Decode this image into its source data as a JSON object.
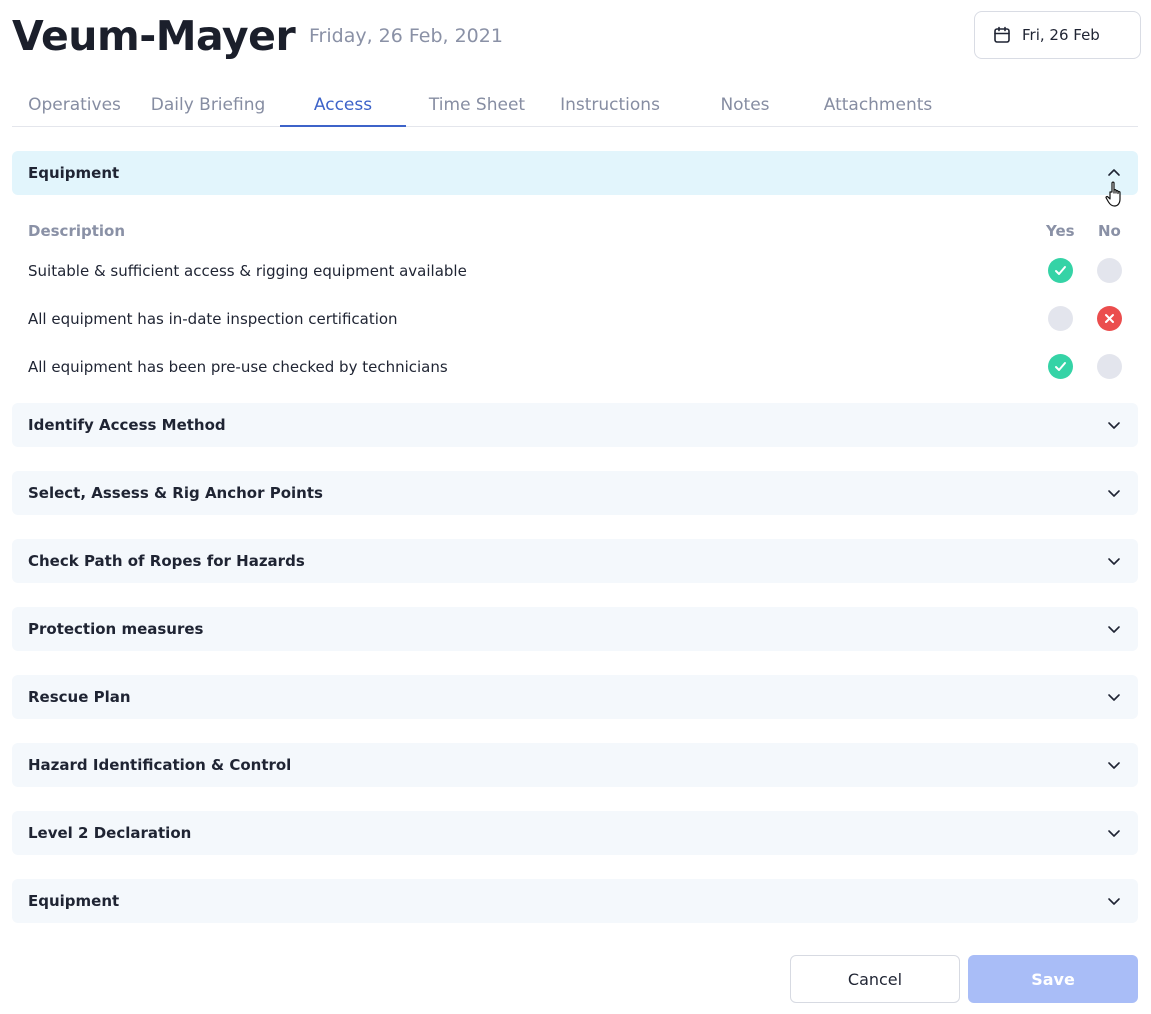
{
  "header": {
    "title": "Veum-Mayer",
    "date_long": "Friday, 26 Feb, 2021",
    "date_button": "Fri, 26 Feb",
    "date_icon": "calendar-icon"
  },
  "tabs": [
    {
      "label": "Operatives",
      "active": false
    },
    {
      "label": "Daily Briefing",
      "active": false
    },
    {
      "label": "Access",
      "active": true
    },
    {
      "label": "Time Sheet",
      "active": false
    },
    {
      "label": "Instructions",
      "active": false
    },
    {
      "label": "Notes",
      "active": false
    },
    {
      "label": "Attachments",
      "active": false
    }
  ],
  "equipment": {
    "title": "Equipment",
    "expanded": true,
    "columns": {
      "description": "Description",
      "yes": "Yes",
      "no": "No"
    },
    "items": [
      {
        "text": "Suitable & sufficient access & rigging equipment available",
        "answer": "yes"
      },
      {
        "text": "All equipment has in-date inspection certification",
        "answer": "no"
      },
      {
        "text": "All equipment has been pre-use checked by technicians",
        "answer": "yes"
      }
    ]
  },
  "collapsed_sections": [
    "Identify Access Method",
    "Select, Assess & Rig Anchor Points",
    "Check Path of Ropes for Hazards",
    "Protection measures",
    "Rescue Plan",
    "Hazard Identification & Control",
    "Level 2 Declaration",
    "Equipment"
  ],
  "actions": {
    "cancel": "Cancel",
    "save": "Save"
  },
  "colors": {
    "accent": "#3d63c9",
    "yes": "#35d3a6",
    "no": "#eb4d4d",
    "open_section_bg": "#e2f5fc",
    "save_disabled": "#a9bdf7"
  }
}
